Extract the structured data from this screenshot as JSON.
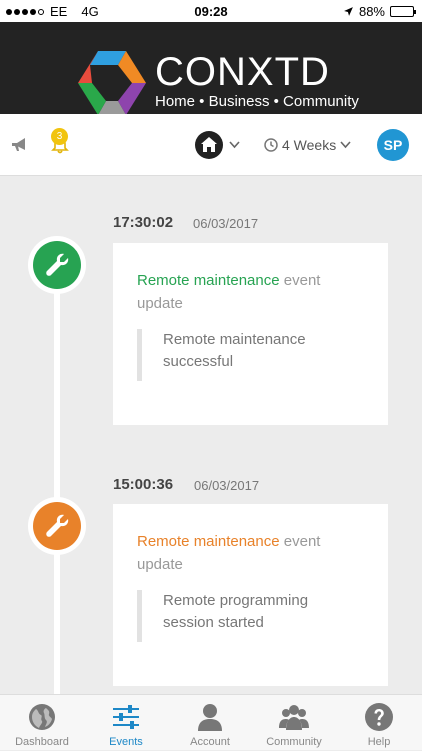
{
  "status_bar": {
    "carrier": "EE",
    "network": "4G",
    "time": "09:28",
    "battery": "88%",
    "battery_level": 0.88
  },
  "brand": {
    "name": "CONXTD",
    "tagline": "Home • Business • Community"
  },
  "toolbar": {
    "notification_count": "3",
    "period": "4 Weeks",
    "user_initials": "SP"
  },
  "events": [
    {
      "time": "17:30:02",
      "date": "06/03/2017",
      "title_highlight": "Remote maintenance",
      "title_rest": " event update",
      "detail": "Remote maintenance successful",
      "color": "#27a352"
    },
    {
      "time": "15:00:36",
      "date": "06/03/2017",
      "title_highlight": "Remote maintenance",
      "title_rest": " event update",
      "detail": "Remote programming session started",
      "color": "#e8822a"
    }
  ],
  "tabs": [
    {
      "label": "Dashboard",
      "icon": "globe-icon"
    },
    {
      "label": "Events",
      "icon": "sliders-icon",
      "active": true
    },
    {
      "label": "Account",
      "icon": "person-icon"
    },
    {
      "label": "Community",
      "icon": "group-icon"
    },
    {
      "label": "Help",
      "icon": "help-icon"
    }
  ],
  "colors": {
    "accent": "#1e88c7",
    "brand_bg": "#232323",
    "avatar": "#2196d3",
    "badge": "#f1c40f"
  }
}
